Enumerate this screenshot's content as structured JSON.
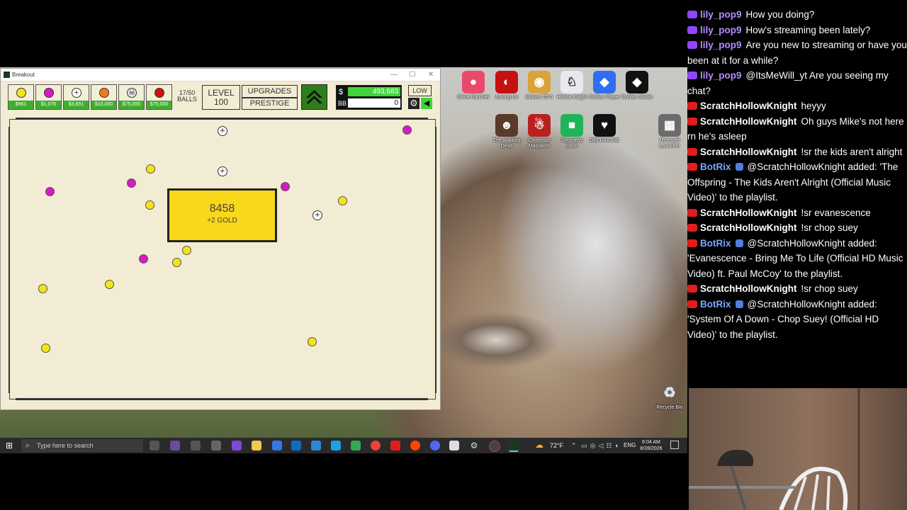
{
  "window": {
    "title": "Breakout",
    "min": "—",
    "max": "☐",
    "close": "✕"
  },
  "hud": {
    "balls": [
      {
        "kind": "basic",
        "color": "#f5e31a",
        "price": "$961"
      },
      {
        "kind": "plasma",
        "color": "#d819c4",
        "price": "$1,076"
      },
      {
        "kind": "scatter",
        "color": "#ffffff",
        "glyph": "+",
        "price": "$3,691"
      },
      {
        "kind": "cannon",
        "color": "#f07a1f",
        "price": "$10,000"
      },
      {
        "kind": "skull",
        "color": "#e8e8e8",
        "glyph": "☠",
        "price": "$75,000"
      },
      {
        "kind": "fire",
        "color": "#cc1111",
        "price": "$75,000"
      }
    ],
    "balls_count": "17/50",
    "balls_label": "BALLS",
    "level_label": "LEVEL",
    "level_value": "100",
    "upgrades_label": "UPGRADES",
    "prestige_label": "PRESTIGE",
    "money_symbol": "$",
    "money_value": "493,683",
    "bb_label": "BB",
    "bb_value": "0",
    "quality_label": "LOW"
  },
  "field": {
    "brick_value": "8458",
    "brick_reward": "+2 GOLD"
  },
  "desktop_icons": [
    {
      "label": "Slime Rancher",
      "color": "#e94a6b"
    },
    {
      "label": "Among Us",
      "color": "#c51111"
    },
    {
      "label": "Bloons TD 6",
      "color": "#d9a23a"
    },
    {
      "label": "Hollow Knight",
      "color": "#e8e8ee"
    },
    {
      "label": "Roblox Player",
      "color": "#2f6df3"
    },
    {
      "label": "Roblox Studio",
      "color": "#111111"
    },
    {
      "label": "The Walking Dead",
      "color": "#5a3a2a"
    },
    {
      "label": "Christmas Massacre",
      "color": "#b82020"
    },
    {
      "label": "Geometry Dash",
      "color": "#1fb45a"
    },
    {
      "label": "DELTARUNE",
      "color": "#111111"
    },
    {
      "label": "Minecraft Launcher",
      "color": "#6b6b6b"
    },
    {
      "label": "Recycle Bin",
      "color": "#9fb7cf"
    }
  ],
  "taskbar": {
    "search_placeholder": "Type here to search",
    "weather": "72°F",
    "lang": "ENG",
    "time": "6:04 AM",
    "date": "8/28/2026"
  },
  "chat": [
    {
      "platform": "twitch",
      "user": "lily_pop9",
      "text": "How you doing?",
      "verified": false
    },
    {
      "platform": "twitch",
      "user": "lily_pop9",
      "text": "How's streaming been lately?",
      "verified": false
    },
    {
      "platform": "twitch",
      "user": "lily_pop9",
      "text": "Are you new to streaming or have you been at it for a while?",
      "verified": false
    },
    {
      "platform": "twitch",
      "user": "lily_pop9",
      "text": "@ItsMeWill_yt Are you seeing my chat?",
      "verified": false
    },
    {
      "platform": "youtube",
      "user": "ScratchHollowKnight",
      "text": "heyyy",
      "verified": false
    },
    {
      "platform": "youtube",
      "user": "ScratchHollowKnight",
      "text": "Oh guys Mike's not here rn he's asleep",
      "verified": false
    },
    {
      "platform": "youtube",
      "user": "ScratchHollowKnight",
      "text": "!sr the kids aren't alright",
      "verified": false
    },
    {
      "platform": "youtube",
      "user": "BotRix",
      "text": "@ScratchHollowKnight added: 'The Offspring - The Kids Aren't Alright (Official Music Video)' to the playlist.",
      "verified": true
    },
    {
      "platform": "youtube",
      "user": "ScratchHollowKnight",
      "text": "!sr evanescence",
      "verified": false
    },
    {
      "platform": "youtube",
      "user": "ScratchHollowKnight",
      "text": "!sr chop suey",
      "verified": false
    },
    {
      "platform": "youtube",
      "user": "BotRix",
      "text": "@ScratchHollowKnight added: 'Evanescence - Bring Me To Life (Official HD Music Video) ft. Paul McCoy' to the playlist.",
      "verified": true
    },
    {
      "platform": "youtube",
      "user": "ScratchHollowKnight",
      "text": "!sr chop suey",
      "verified": false
    },
    {
      "platform": "youtube",
      "user": "BotRix",
      "text": "@ScratchHollowKnight added: 'System Of A Down - Chop Suey! (Official HD Video)' to the playlist.",
      "verified": true
    }
  ]
}
